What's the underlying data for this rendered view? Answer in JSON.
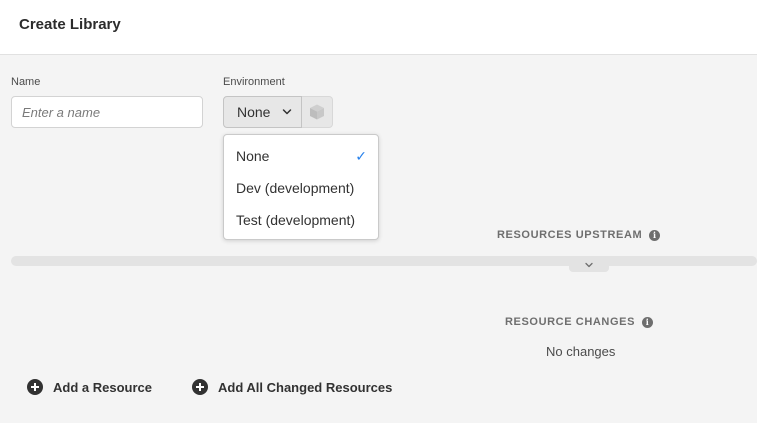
{
  "header": {
    "title": "Create Library"
  },
  "form": {
    "name_label": "Name",
    "name_placeholder": "Enter a name",
    "name_value": "",
    "environment_label": "Environment",
    "environment_selected": "None",
    "environment_icon": "package-icon"
  },
  "environment_dropdown": {
    "options": [
      {
        "label": "None",
        "selected": true
      },
      {
        "label": "Dev (development)",
        "selected": false
      },
      {
        "label": "Test (development)",
        "selected": false
      }
    ],
    "check_glyph": "✓"
  },
  "resources_upstream": {
    "heading": "RESOURCES UPSTREAM",
    "info_glyph": "i"
  },
  "resource_changes": {
    "heading": "RESOURCE CHANGES",
    "info_glyph": "i",
    "empty_text": "No changes"
  },
  "actions": {
    "add_resource": "Add a Resource",
    "add_all_changed": "Add All Changed Resources"
  },
  "colors": {
    "accent": "#2680eb",
    "background": "#f4f4f4",
    "header_bg": "#ffffff"
  }
}
